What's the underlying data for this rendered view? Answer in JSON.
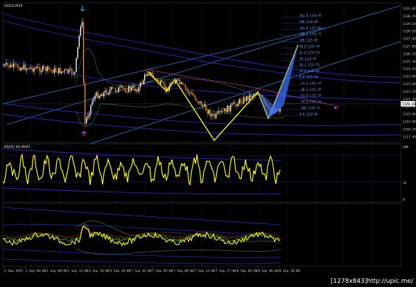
{
  "window": {
    "symbol": "GOLD,M15",
    "rsi_label": "RSI(5) 64.4047",
    "price_scale": [
      "1131.05",
      "1130.25",
      "1129.45",
      "1128.65",
      "1127.85",
      "1127.05",
      "1126.25",
      "1125.45",
      "1124.65",
      "1123.85",
      "1123.05",
      "1122.25",
      "1121.45",
      "1120.65",
      "1119.85",
      "1119.05",
      "1118.25",
      "1117.45"
    ],
    "current_price": "1120.36",
    "rsi_scale": [
      "100",
      "32",
      "0"
    ],
    "time_axis": [
      "1 Sep 2015",
      "1 Sep 04:00",
      "1 Sep 08:00",
      "1 Sep 12:00",
      "4 Sep 16:00",
      "4 Sep 20:00",
      "7 Sep 01:00",
      "7 Sep 05:00",
      "7 Sep 09:00",
      "7 Sep 13:00",
      "7 Sep 17:00",
      "8 Sep 02:00",
      "8 Sep 06:00",
      "8 Sep 10:00"
    ]
  },
  "fibonacci_levels": [
    "261.8 1128.95",
    "200 1128.05",
    "161.8 1127.05",
    "138.2 1126.75",
    "100 1125.85",
    "88.6 1125.45",
    "61.8 1124.55",
    "50 1124.05",
    "38.2 1123.55",
    "23.6 1123.05",
    "0.0 1122.75",
    "-23.6 1122.45",
    "-38.2 1121.95",
    "-61.8 1121.55",
    "-78.6 1121.25",
    "-100 1120.75",
    "0.0 1119.05"
  ],
  "watermark": "[1278x843]http://upic.me/",
  "colors": {
    "background": "#000000",
    "bull_candle": "#ffffff",
    "bear_candle": "#ff8c00",
    "pattern": "#ffff00",
    "channel": "#2c7fd1",
    "bands": "#1f2ccc",
    "rsi": "#ffff00",
    "rsi_dots": "#ff40ff",
    "volume_arrow": "#4aa0ff"
  }
}
